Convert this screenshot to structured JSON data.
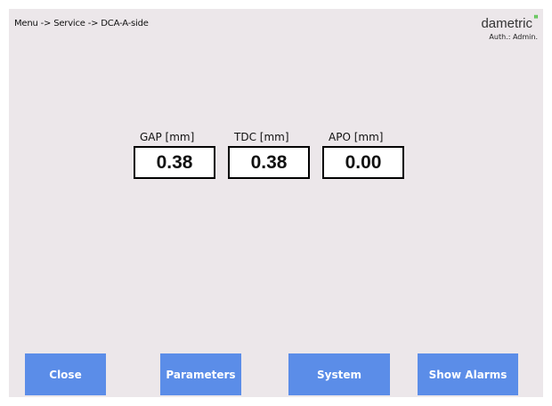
{
  "header": {
    "breadcrumb": "Menu -> Service -> DCA-A-side",
    "logo": "dametric",
    "auth": "Auth.: Admin."
  },
  "fields": [
    {
      "label": "GAP [mm]",
      "value": "0.38"
    },
    {
      "label": "TDC [mm]",
      "value": "0.38"
    },
    {
      "label": "APO [mm]",
      "value": "0.00"
    }
  ],
  "buttons": {
    "close": "Close",
    "parameters": "Parameters",
    "system": "System",
    "show_alarms": "Show Alarms"
  },
  "colors": {
    "background": "#ece7ea",
    "button": "#5b8de8",
    "logo_accent": "#59c34f"
  }
}
